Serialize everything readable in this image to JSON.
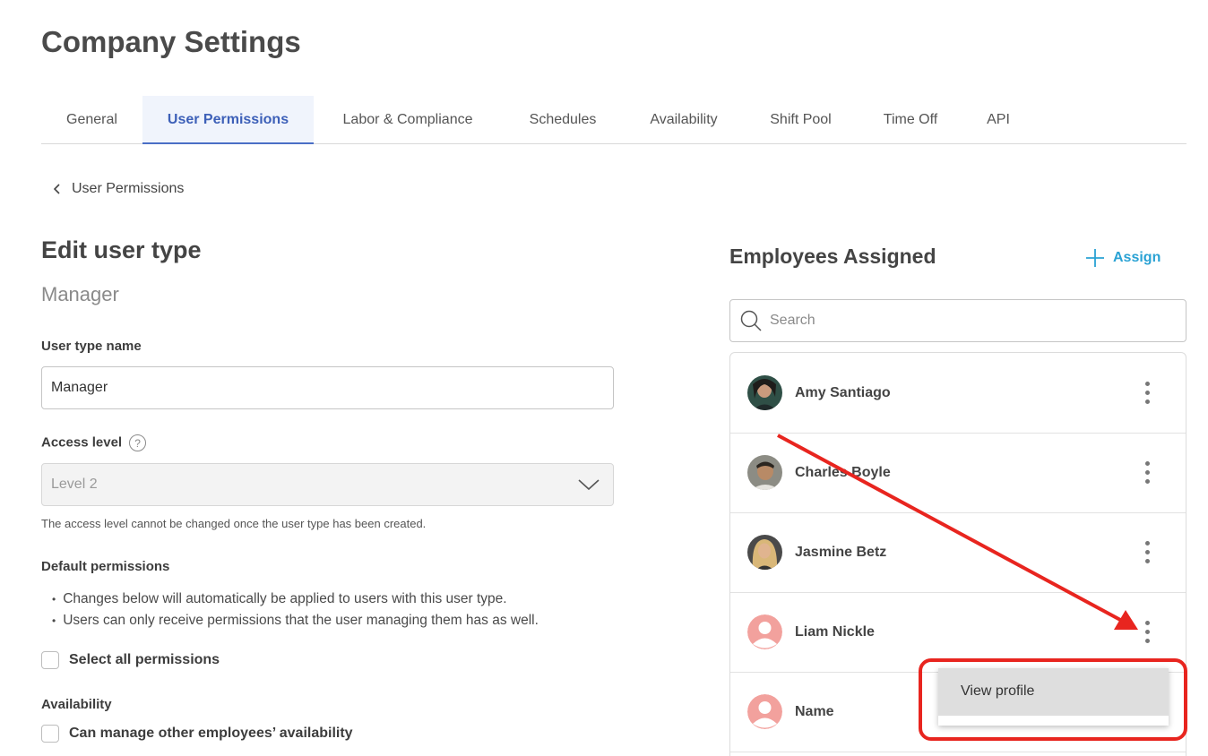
{
  "page": {
    "title": "Company Settings"
  },
  "tabs": [
    {
      "label": "General"
    },
    {
      "label": "User Permissions",
      "active": true
    },
    {
      "label": "Labor & Compliance"
    },
    {
      "label": "Schedules"
    },
    {
      "label": "Availability"
    },
    {
      "label": "Shift Pool"
    },
    {
      "label": "Time Off"
    },
    {
      "label": "API"
    }
  ],
  "breadcrumb": {
    "label": "User Permissions"
  },
  "edit": {
    "title": "Edit user type",
    "subtitle": "Manager",
    "name_label": "User type name",
    "name_value": "Manager",
    "access_label": "Access level",
    "access_help": "?",
    "access_value": "Level 2",
    "access_helper": "The access level cannot be changed once the user type has been created.",
    "default_label": "Default permissions",
    "bullets": [
      "Changes below will automatically be applied to users with this user type.",
      "Users can only receive permissions that the user managing them has as well."
    ],
    "select_all": "Select all permissions",
    "availability_label": "Availability",
    "availability_option": "Can manage other employees’ availability"
  },
  "employees": {
    "title": "Employees Assigned",
    "assign_label": "Assign",
    "search_placeholder": "Search",
    "list": [
      {
        "name": "Amy Santiago",
        "avatar": "photo"
      },
      {
        "name": "Charles Boyle",
        "avatar": "photo"
      },
      {
        "name": "Jasmine Betz",
        "avatar": "photo"
      },
      {
        "name": "Liam Nickle",
        "avatar": "placeholder"
      },
      {
        "name": "Name",
        "avatar": "placeholder"
      }
    ]
  },
  "dropdown": {
    "item": "View profile"
  },
  "colors": {
    "accent": "#2aa2d4",
    "tab_active": "#3d60b8",
    "annotation": "#e8251f",
    "placeholder_avatar": "#f2a19d"
  }
}
